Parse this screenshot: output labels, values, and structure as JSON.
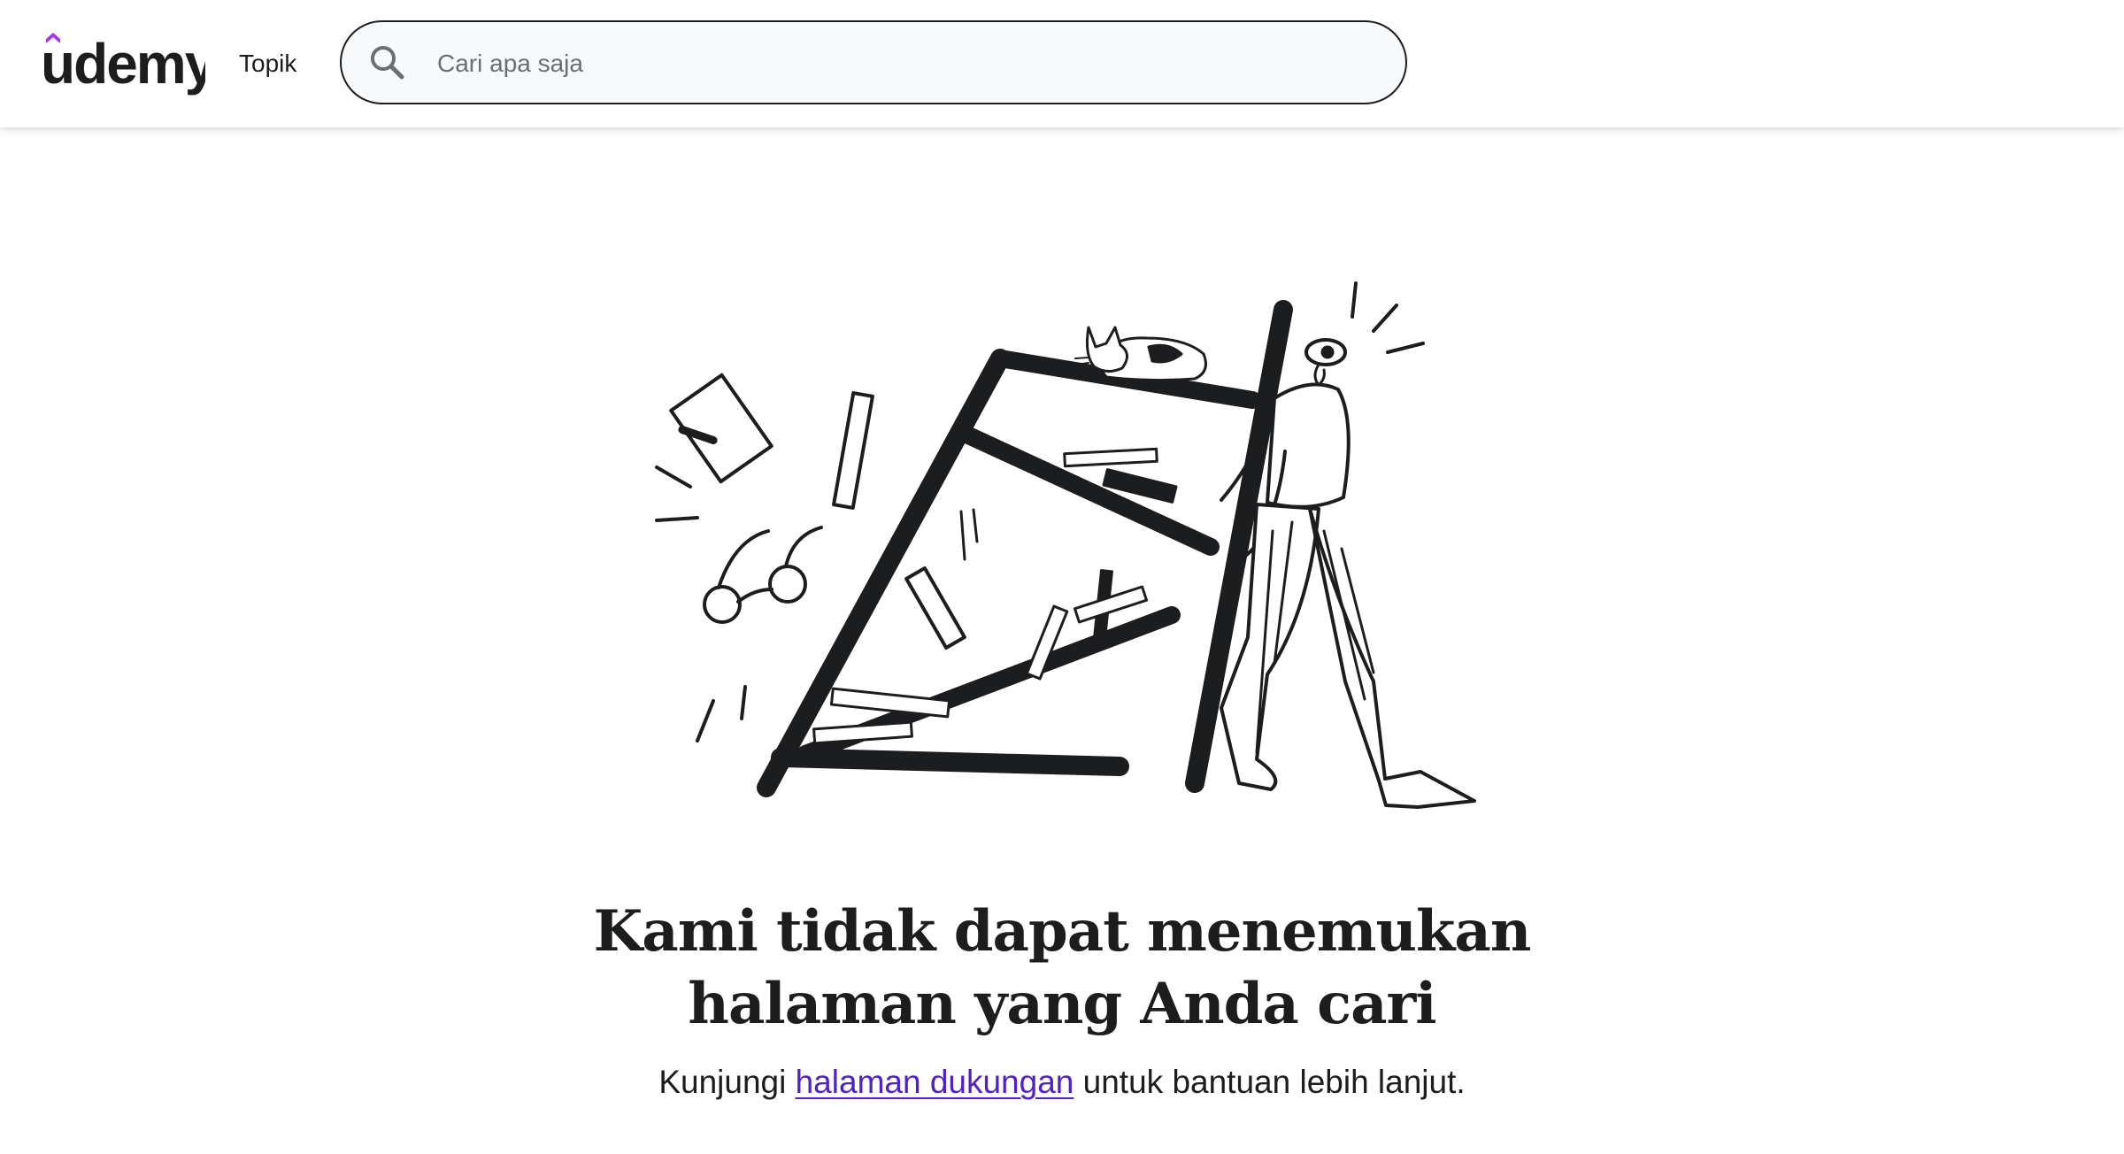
{
  "header": {
    "logo_text": "udemy",
    "nav_topik": "Topik",
    "search": {
      "placeholder": "Cari apa saja",
      "value": ""
    }
  },
  "icons": {
    "search": "search-icon",
    "logo": "udemy-logo"
  },
  "main": {
    "title_line1": "Kami tidak dapat menemukan",
    "title_line2": "halaman yang Anda cari",
    "subtitle_before": "Kunjungi ",
    "subtitle_link": "halaman dukungan",
    "subtitle_after": " untuk bantuan lebih lanjut."
  },
  "colors": {
    "brand_purple": "#a435f0",
    "link": "#5022c3",
    "text": "#1c1d1f",
    "search_bg": "#f7f9fa"
  }
}
